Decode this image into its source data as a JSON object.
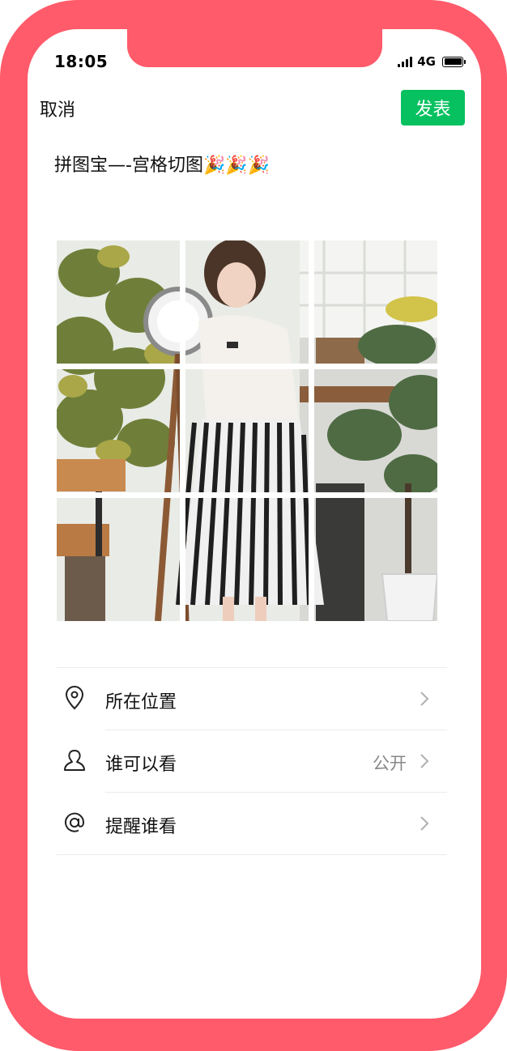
{
  "status_bar": {
    "time": "18:05",
    "network": "4G",
    "battery_level": 0.9
  },
  "header": {
    "cancel_label": "取消",
    "publish_label": "发表"
  },
  "post": {
    "text": "拼图宝—-宫格切图🎉🎉🎉"
  },
  "photo_grid": {
    "rows": 3,
    "columns": 3,
    "image_description_icon": "photo-tile"
  },
  "menu": {
    "items": [
      {
        "icon": "location-pin-icon",
        "label": "所在位置",
        "value": ""
      },
      {
        "icon": "person-icon",
        "label": "谁可以看",
        "value": "公开"
      },
      {
        "icon": "at-sign-icon",
        "label": "提醒谁看",
        "value": ""
      }
    ]
  },
  "colors": {
    "frame": "#ff5b6b",
    "publish_button": "#07c160",
    "text_primary": "#111111",
    "text_secondary": "#888888"
  }
}
